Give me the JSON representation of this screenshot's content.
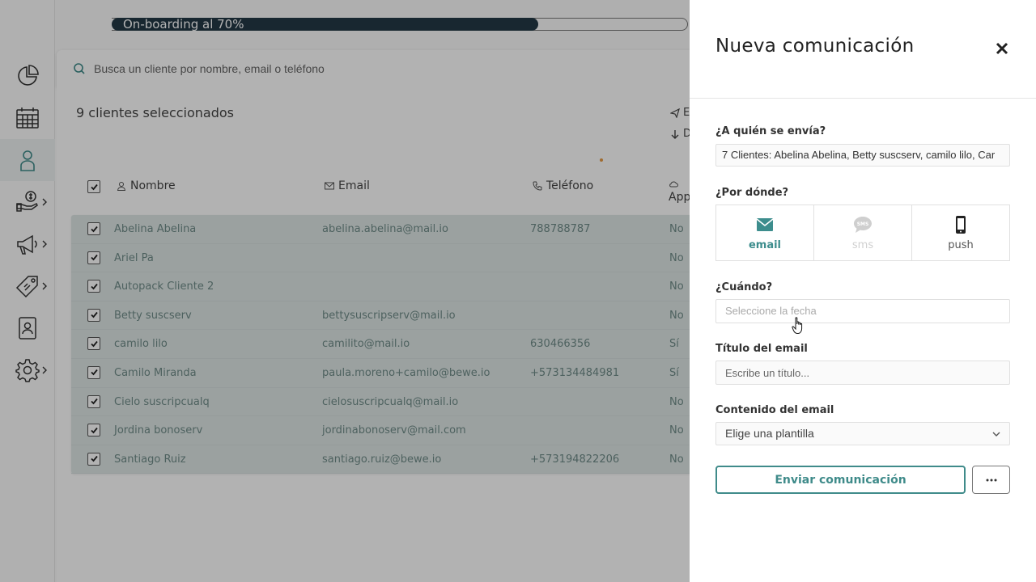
{
  "onboarding": {
    "label": "On-boarding al 70%",
    "progress": 0.74
  },
  "sidebar": {
    "items": [
      {
        "icon": "pie-chart-icon",
        "chevron": false,
        "active": false
      },
      {
        "icon": "calendar-icon",
        "chevron": false,
        "active": false
      },
      {
        "icon": "user-icon",
        "chevron": false,
        "active": true
      },
      {
        "icon": "money-hand-icon",
        "chevron": true,
        "active": false
      },
      {
        "icon": "megaphone-icon",
        "chevron": true,
        "active": false
      },
      {
        "icon": "tag-icon",
        "chevron": true,
        "active": false
      },
      {
        "icon": "id-badge-icon",
        "chevron": false,
        "active": false
      },
      {
        "icon": "gear-icon",
        "chevron": true,
        "active": false
      }
    ]
  },
  "search": {
    "placeholder": "Busca un cliente por nombre, email o teléfono"
  },
  "selection": {
    "count_label": "9 clientes seleccionados",
    "action_1": "E",
    "action_2": "D"
  },
  "table": {
    "headers": {
      "name": "Nombre",
      "email": "Email",
      "phone": "Teléfono",
      "app": "App"
    },
    "rows": [
      {
        "name": "Abelina Abelina",
        "email": "abelina.abelina@mail.io",
        "phone": "788788787",
        "app": "No"
      },
      {
        "name": "Ariel Pa",
        "email": "",
        "phone": "",
        "app": "No"
      },
      {
        "name": "Autopack Cliente 2",
        "email": "",
        "phone": "",
        "app": "No"
      },
      {
        "name": "Betty suscserv",
        "email": "bettysuscripserv@mail.io",
        "phone": "",
        "app": "No"
      },
      {
        "name": "camilo lilo",
        "email": "camilito@mail.io",
        "phone": "630466356",
        "app": "Sí"
      },
      {
        "name": "Camilo Miranda",
        "email": "paula.moreno+camilo@bewe.io",
        "phone": "+573134484981",
        "app": "Sí"
      },
      {
        "name": "Cielo suscripcualq",
        "email": "cielosuscripcualq@mail.io",
        "phone": "",
        "app": "No"
      },
      {
        "name": "Jordina bonoserv",
        "email": "jordinabonoserv@mail.com",
        "phone": "",
        "app": "No"
      },
      {
        "name": "Santiago Ruiz",
        "email": "santiago.ruiz@bewe.io",
        "phone": "+573194822206",
        "app": "No"
      }
    ]
  },
  "panel": {
    "title": "Nueva comunicación",
    "to_label": "¿A quién se envía?",
    "to_value": "7 Clientes: Abelina Abelina, Betty suscserv, camilo lilo, Car",
    "via_label": "¿Por dónde?",
    "channels": {
      "email": "email",
      "sms": "sms",
      "push": "push"
    },
    "sms_badge": "SMS",
    "when_label": "¿Cuándo?",
    "date_placeholder": "Seleccione la fecha",
    "email_title_label": "Título del email",
    "email_title_placeholder": "Escribe un título...",
    "content_label": "Contenido del email",
    "template_select": "Elige una plantilla",
    "send_button": "Enviar comunicación"
  },
  "colors": {
    "accent": "#3f8b8a",
    "onboarding_fill": "#233946",
    "row_bg": "#dfe7e6"
  }
}
